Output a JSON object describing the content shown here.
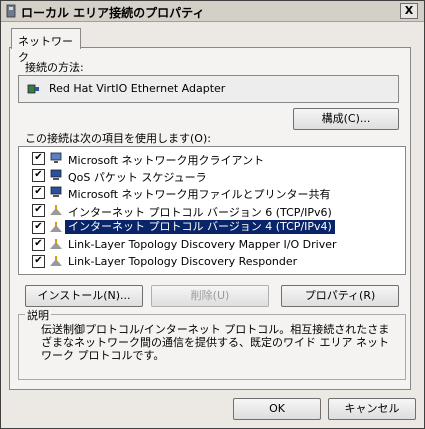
{
  "window": {
    "title": "ローカル エリア接続のプロパティ",
    "close_label": "X"
  },
  "tabs": [
    {
      "label": "ネットワーク"
    }
  ],
  "connect_using": {
    "label": "接続の方法:",
    "adapter_name": "Red Hat VirtIO Ethernet Adapter"
  },
  "configure_button": "構成(C)...",
  "items_label": "この接続は次の項目を使用します(O):",
  "items": [
    {
      "label": "Microsoft ネットワーク用クライアント",
      "checked": true,
      "icon": "client-icon"
    },
    {
      "label": "QoS パケット スケジューラ",
      "checked": true,
      "icon": "qos-icon"
    },
    {
      "label": "Microsoft ネットワーク用ファイルとプリンター共有",
      "checked": true,
      "icon": "share-icon"
    },
    {
      "label": "インターネット プロトコル バージョン 6 (TCP/IPv6)",
      "checked": true,
      "icon": "protocol-icon"
    },
    {
      "label": "インターネット プロトコル バージョン 4 (TCP/IPv4)",
      "checked": true,
      "icon": "protocol-icon",
      "selected": true
    },
    {
      "label": "Link-Layer Topology Discovery Mapper I/O Driver",
      "checked": true,
      "icon": "protocol-icon"
    },
    {
      "label": "Link-Layer Topology Discovery Responder",
      "checked": true,
      "icon": "protocol-icon"
    }
  ],
  "buttons": {
    "install": "インストール(N)...",
    "uninstall": "削除(U)",
    "properties": "プロパティ(R)"
  },
  "description": {
    "title": "説明",
    "text": "伝送制御プロトコル/インターネット プロトコル。相互接続されたさまざまなネットワーク間の通信を提供する、既定のワイド エリア ネットワーク プロトコルです。"
  },
  "footer": {
    "ok": "OK",
    "cancel": "キャンセル"
  }
}
